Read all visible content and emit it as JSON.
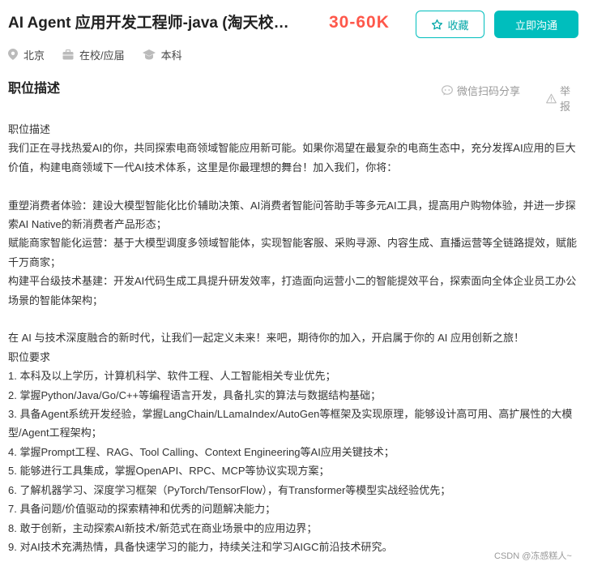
{
  "header": {
    "title": "AI Agent 应用开发工程师-java (淘天校…",
    "salary": "30-60K",
    "fav_label": "收藏",
    "chat_label": "立即沟通",
    "fav_icon": "star-icon"
  },
  "meta": {
    "location": "北京",
    "status": "在校/应届",
    "education": "本科"
  },
  "section": {
    "title": "职位描述",
    "share_label": "微信扫码分享",
    "report_label": "举报"
  },
  "description": [
    "职位描述",
    "我们正在寻找热爱AI的你，共同探索电商领域智能应用新可能。如果你渴望在最复杂的电商生态中，充分发挥AI应用的巨大价值，构建电商领域下一代AI技术体系，这里是你最理想的舞台！加入我们，你将：",
    "",
    "重塑消费者体验：建设大模型智能化比价辅助决策、AI消费者智能问答助手等多元AI工具，提高用户购物体验，并进一步探索AI Native的新消费者产品形态；",
    "赋能商家智能化运营：基于大模型调度多领域智能体，实现智能客服、采购寻源、内容生成、直播运营等全链路提效，赋能千万商家；",
    "构建平台级技术基建：开发AI代码生成工具提升研发效率，打造面向运营小二的智能提效平台，探索面向全体企业员工办公场景的智能体架构；",
    "",
    "在 AI 与技术深度融合的新时代，让我们一起定义未来！来吧，期待你的加入，开启属于你的 AI 应用创新之旅！",
    "职位要求",
    "1. 本科及以上学历，计算机科学、软件工程、人工智能相关专业优先；",
    "2. 掌握Python/Java/Go/C++等编程语言开发，具备扎实的算法与数据结构基础；",
    "3. 具备Agent系统开发经验，掌握LangChain/LLamaIndex/AutoGen等框架及实现原理，能够设计高可用、高扩展性的大模型/Agent工程架构；",
    "4. 掌握Prompt工程、RAG、Tool Calling、Context Engineering等AI应用关键技术；",
    "5. 能够进行工具集成，掌握OpenAPI、RPC、MCP等协议实现方案；",
    "6. 了解机器学习、深度学习框架（PyTorch/TensorFlow），有Transformer等模型实战经验优先；",
    "7. 具备问题/价值驱动的探索精神和优秀的问题解决能力；",
    "8. 敢于创新，主动探索AI新技术/新范式在商业场景中的应用边界；",
    "9. 对AI技术充满热情，具备快速学习的能力，持续关注和学习AIGC前沿技术研究。"
  ],
  "watermark": "CSDN @冻感糕人~"
}
